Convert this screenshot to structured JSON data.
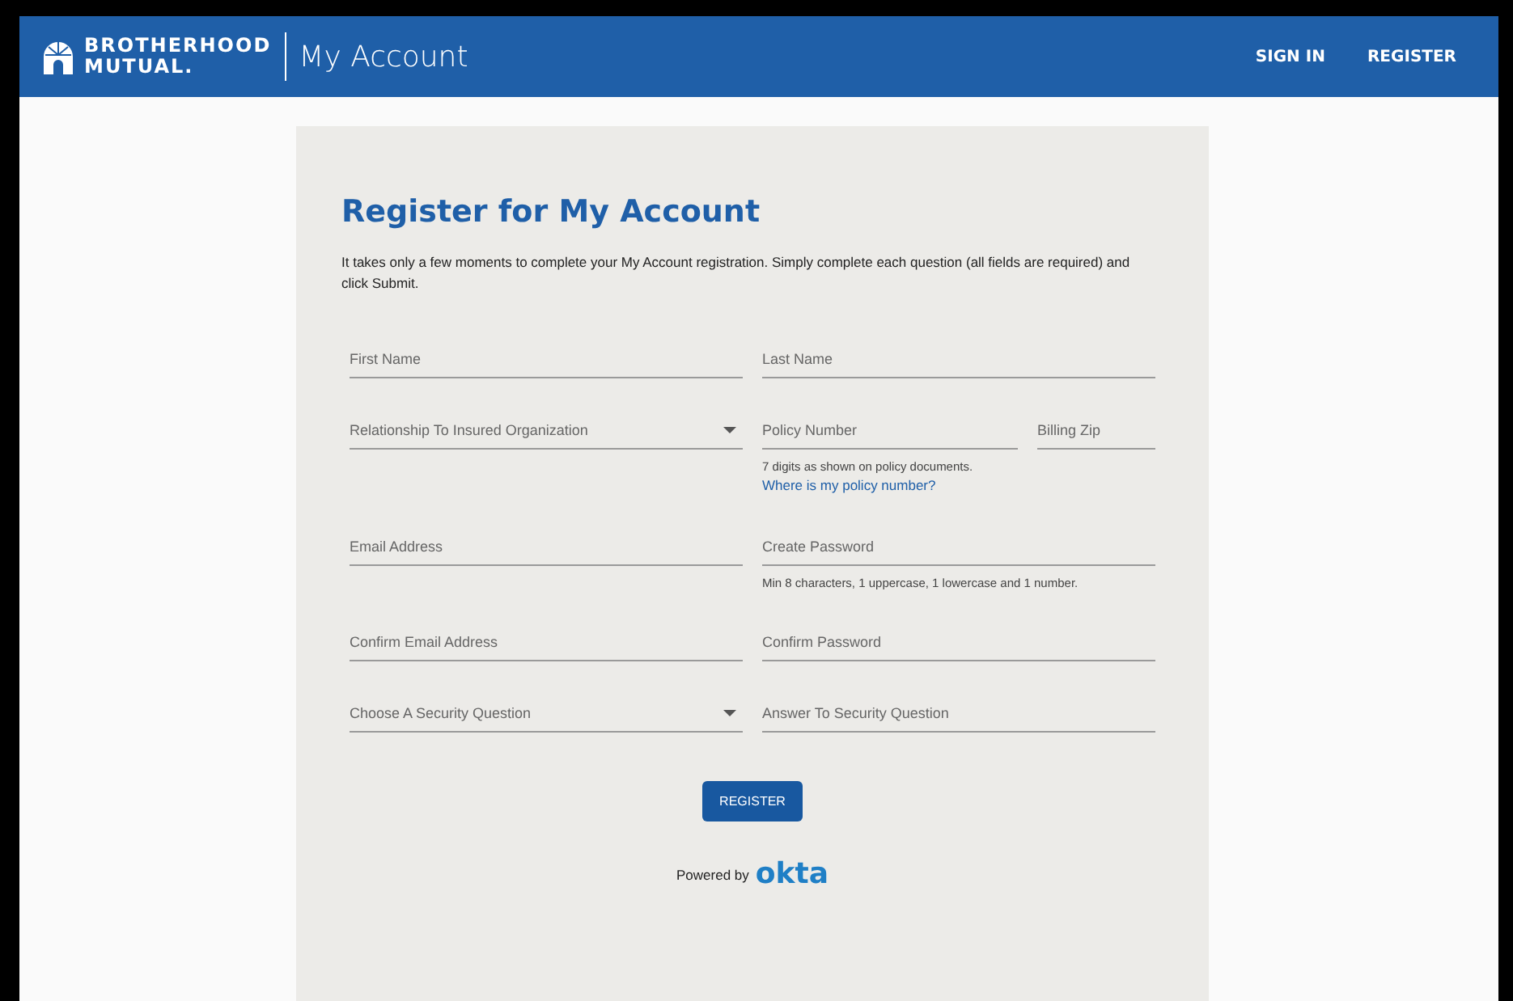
{
  "header": {
    "brand_lines": [
      "BROTHERHOOD",
      "MUTUAL."
    ],
    "title": "My Account",
    "nav": [
      "SIGN IN",
      "REGISTER"
    ]
  },
  "form": {
    "heading": "Register for My Account",
    "intro": "It takes only a few moments to complete your My Account registration. Simply complete each question (all fields are required) and click Submit.",
    "rows": [
      {
        "columns": [
          {
            "fields": [
              {
                "kind": "text",
                "placeholder": "First Name"
              }
            ]
          },
          {
            "fields": [
              {
                "kind": "text",
                "placeholder": "Last Name"
              }
            ]
          }
        ]
      },
      {
        "columns": [
          {
            "fields": [
              {
                "kind": "select",
                "placeholder": "Relationship To Insured Organization"
              }
            ]
          },
          {
            "fields": [
              {
                "kind": "text",
                "placeholder": "Policy Number"
              },
              {
                "kind": "text",
                "placeholder": "Billing Zip"
              }
            ],
            "hint": "7 digits as shown on policy documents.",
            "link": "Where is my policy number?"
          }
        ]
      },
      {
        "columns": [
          {
            "fields": [
              {
                "kind": "text",
                "placeholder": "Email Address"
              }
            ]
          },
          {
            "fields": [
              {
                "kind": "password",
                "placeholder": "Create Password"
              }
            ],
            "hint": "Min 8 characters, 1 uppercase, 1 lowercase and 1 number."
          }
        ]
      },
      {
        "columns": [
          {
            "fields": [
              {
                "kind": "text",
                "placeholder": "Confirm Email Address"
              }
            ]
          },
          {
            "fields": [
              {
                "kind": "password",
                "placeholder": "Confirm Password"
              }
            ]
          }
        ]
      },
      {
        "columns": [
          {
            "fields": [
              {
                "kind": "select",
                "placeholder": "Choose A Security Question"
              }
            ]
          },
          {
            "fields": [
              {
                "kind": "text",
                "placeholder": "Answer To Security Question"
              }
            ]
          }
        ]
      }
    ],
    "submit": "REGISTER",
    "powered_by": "Powered by",
    "powered_logo": "okta"
  }
}
